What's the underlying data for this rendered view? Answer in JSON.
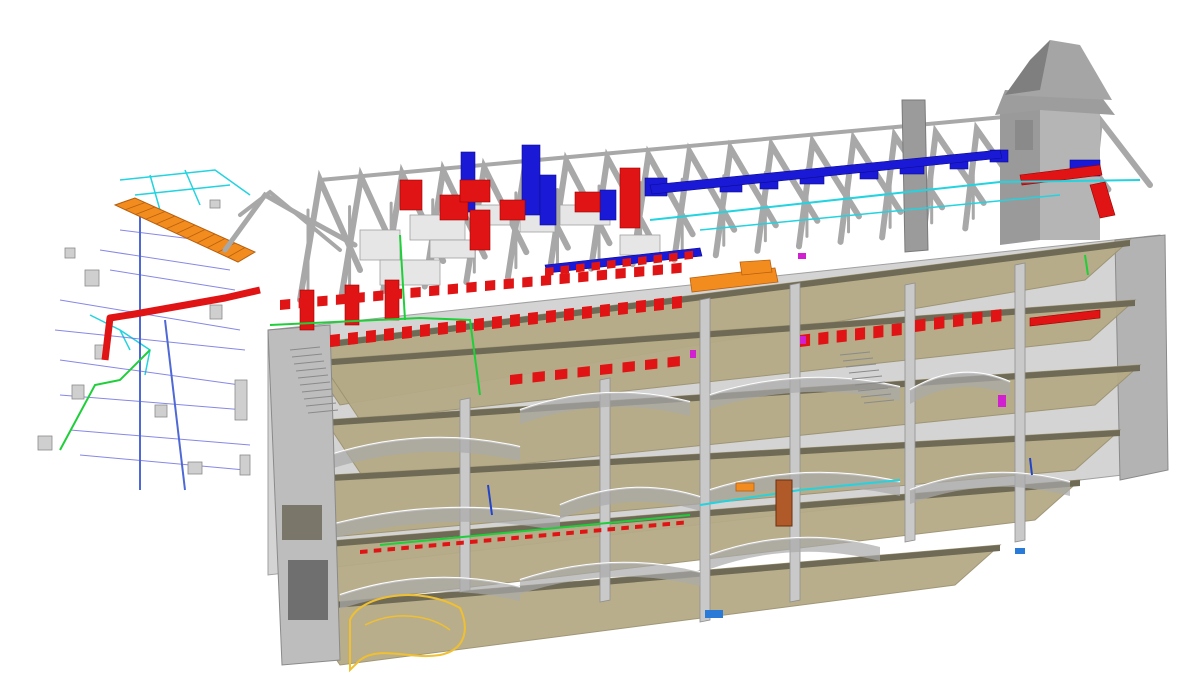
{
  "model": {
    "colors": {
      "background": "#ffffff",
      "floor_slab": "#b5aa86",
      "floor_slab_dark": "#9c9270",
      "wall_section": "#c9c9c9",
      "wall_shadow": "#8f8f8f",
      "roof_truss": "#a8a8a8",
      "supply_duct": "#e01414",
      "return_duct": "#1a1ad6",
      "cold_water_pipe": "#22d3e0",
      "hot_water_pipe": "#1fcf3a",
      "drain_pipe": "#2244cc",
      "cable_tray": "#f28c1e",
      "outline_vault": "#f0c030",
      "accent_magenta": "#d020d0"
    },
    "icons": [
      "isometric-building-section",
      "mep-network",
      "roof-trusses",
      "spire-tower"
    ]
  }
}
